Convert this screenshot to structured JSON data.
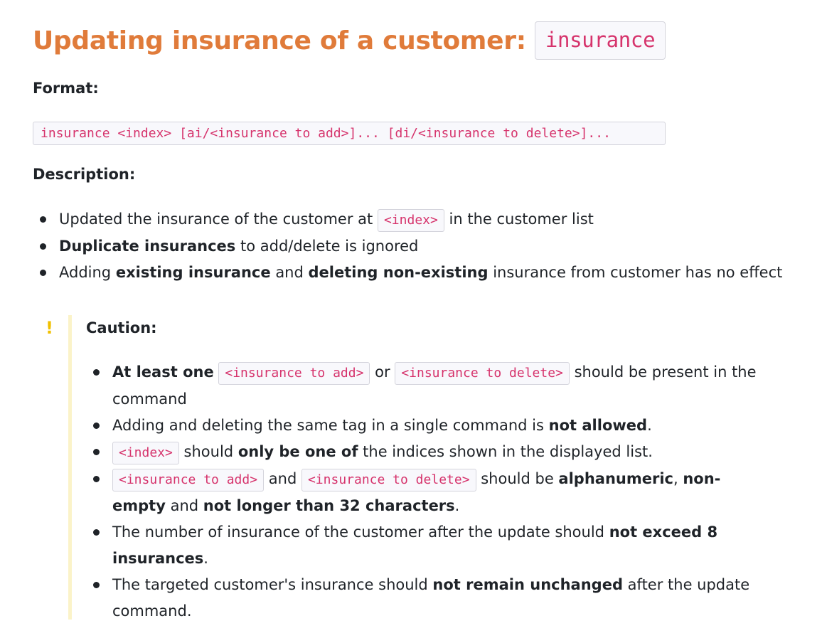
{
  "title": {
    "text": "Updating insurance of a customer:",
    "command": "insurance"
  },
  "format": {
    "label": "Format:",
    "syntax": "insurance <index> [ai/<insurance to add>]... [di/<insurance to delete>]..."
  },
  "description": {
    "label": "Description:",
    "items": [
      {
        "p1": "Updated the insurance of the customer at",
        "code": "<index>",
        "p2": "in the customer list"
      },
      {
        "b1": "Duplicate insurances",
        "p1": "to add/delete is ignored"
      },
      {
        "p1": "Adding",
        "b1": "existing insurance",
        "p2": "and",
        "b2": "deleting non-existing",
        "p3": "insurance from customer has no effect"
      }
    ]
  },
  "caution": {
    "icon": "exclamation-icon",
    "icon_glyph": "!",
    "label": "Caution:",
    "items": [
      {
        "b1": "At least one",
        "code1": "<insurance to add>",
        "p1": "or",
        "code2": "<insurance to delete>",
        "p2": "should be present in the command"
      },
      {
        "p1": "Adding and deleting the same tag in a single command is",
        "b1": "not allowed",
        "p2": "."
      },
      {
        "code1": "<index>",
        "p1": "should",
        "b1": "only be one of",
        "p2": "the indices shown in the displayed list."
      },
      {
        "code1": "<insurance to add>",
        "p1": "and",
        "code2": "<insurance to delete>",
        "p2": "should be",
        "b1": "alphanumeric",
        "p3": ",",
        "b2": "non-empty",
        "p4": "and",
        "b3": "not longer than 32 characters",
        "p5": "."
      },
      {
        "p1": "The number of insurance of the customer after the update should",
        "b1": "not exceed 8 insurances",
        "p2": "."
      },
      {
        "p1": "The targeted customer's insurance should",
        "b1": "not remain unchanged",
        "p2": "after the update command."
      }
    ]
  },
  "colors": {
    "title": "#e07b3a",
    "code_text": "#d6336c",
    "code_bg": "#f8f8fc",
    "caution_bar": "#fbf3c9",
    "caution_icon": "#f0c000"
  }
}
